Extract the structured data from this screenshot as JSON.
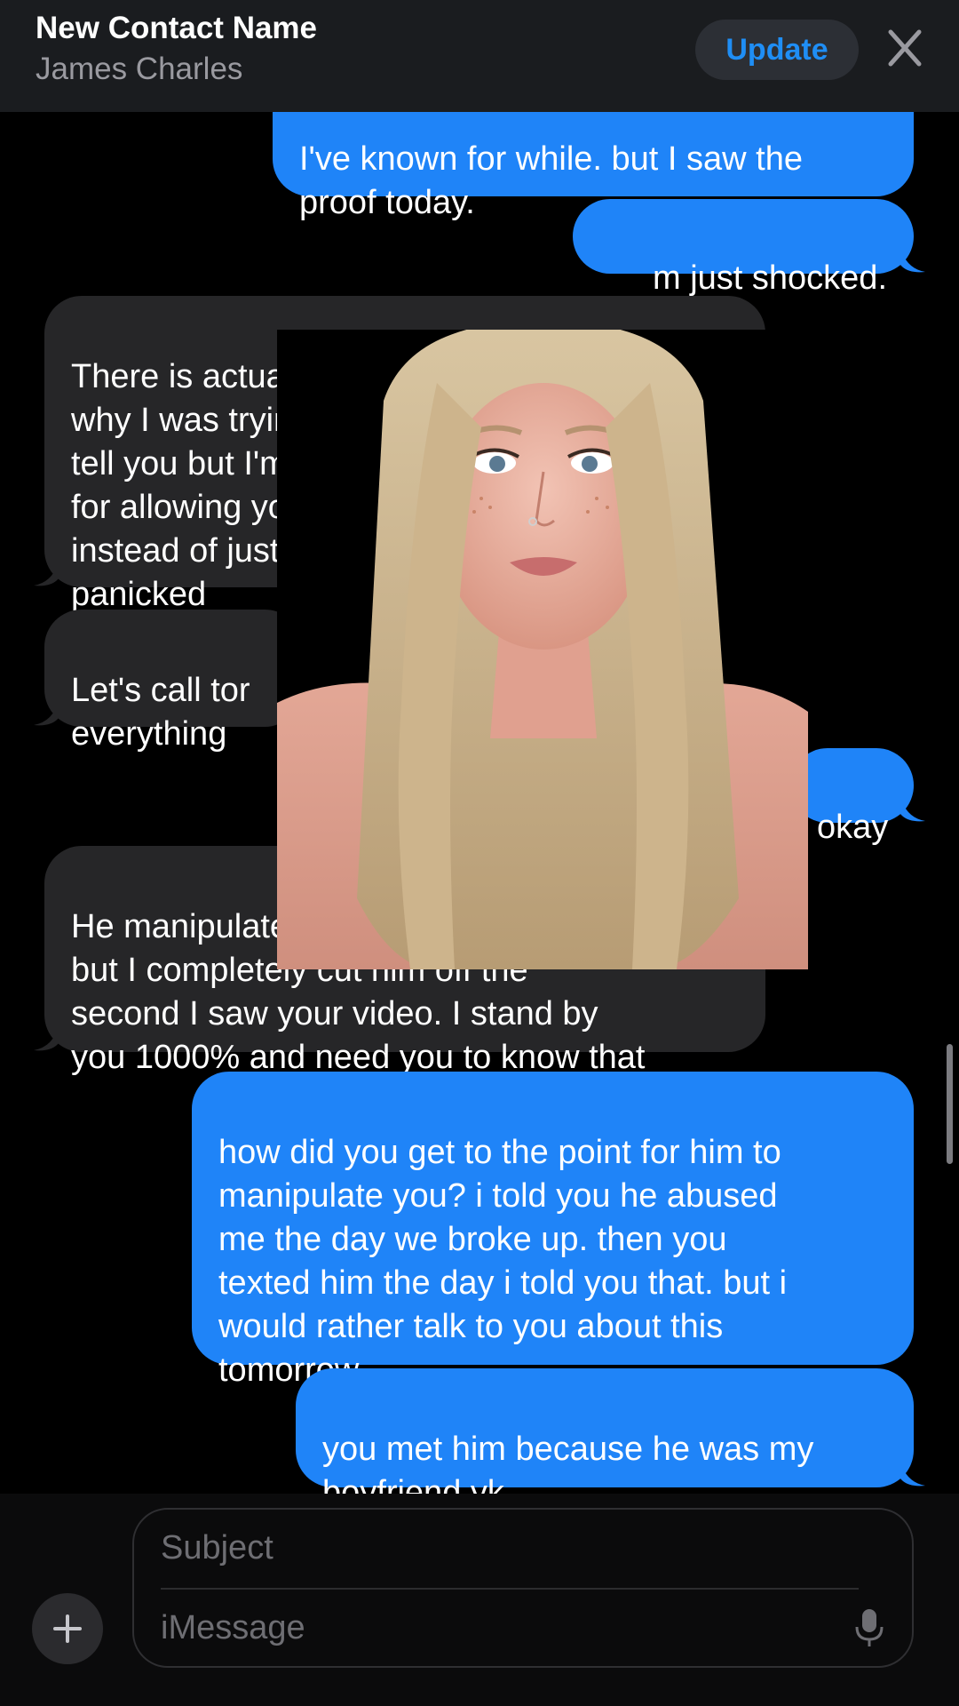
{
  "header": {
    "title": "New Contact Name",
    "subtitle": "James Charles",
    "update_label": "Update",
    "close_icon": "close-icon"
  },
  "messages": [
    {
      "type": "sent",
      "text": "I've known for while. but I saw the\nproof today."
    },
    {
      "type": "sent",
      "text": "m just shocked."
    },
    {
      "type": "received",
      "text": "There is actually a t               hat's\nwhy I was trying to                    to\ntell you but I'm an                     lf\nfor allowing you t                       y\ninstead of just te                     ut I\npanicked"
    },
    {
      "type": "received",
      "text": "Let's call tor\neverything"
    },
    {
      "type": "sent",
      "text": "okay"
    },
    {
      "type": "received",
      "text": "He manipulated me as well & I fell for it\nbut I completely cut him off the\nsecond I saw your video. I stand by\nyou 1000% and need you to know that"
    },
    {
      "type": "sent",
      "text": "how did you get to the point for him to\nmanipulate you? i told you he abused\nme the day we broke up. then you\ntexted him the day i told you that. but i\nwould rather talk to you about this\ntomorrow."
    },
    {
      "type": "sent",
      "text": "you met him because he was my\nboyfriend yk"
    }
  ],
  "composer": {
    "subject_placeholder": "Subject",
    "message_placeholder": "iMessage",
    "plus_icon": "plus-icon",
    "mic_icon": "microphone-icon"
  },
  "colors": {
    "sent_bubble": "#1f84f8",
    "received_bubble": "#262628",
    "accent": "#1f8ef5",
    "header_bg": "#1a1c1f"
  }
}
